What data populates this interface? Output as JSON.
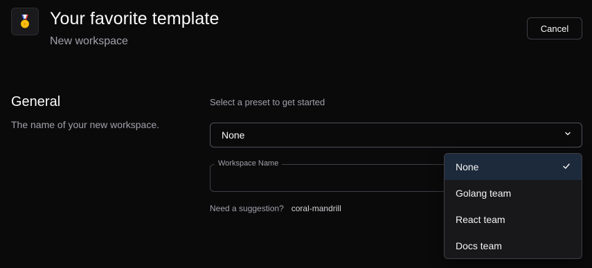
{
  "header": {
    "icon": "medal-icon",
    "title": "Your favorite template",
    "subtitle": "New workspace",
    "cancel_label": "Cancel"
  },
  "general": {
    "title": "General",
    "description": "The name of your new workspace."
  },
  "preset": {
    "label": "Select a preset to get started",
    "selected": "None",
    "options": [
      {
        "label": "None",
        "selected": true
      },
      {
        "label": "Golang team",
        "selected": false
      },
      {
        "label": "React team",
        "selected": false
      },
      {
        "label": "Docs team",
        "selected": false
      }
    ]
  },
  "workspace_name": {
    "label": "Workspace Name",
    "value": "",
    "suggestion_prompt": "Need a suggestion?",
    "suggestion_value": "coral-mandrill"
  },
  "colors": {
    "background": "#0a0a0b",
    "selected_option_bg": "#1d2a3b",
    "muted_text": "#a1a1aa"
  }
}
